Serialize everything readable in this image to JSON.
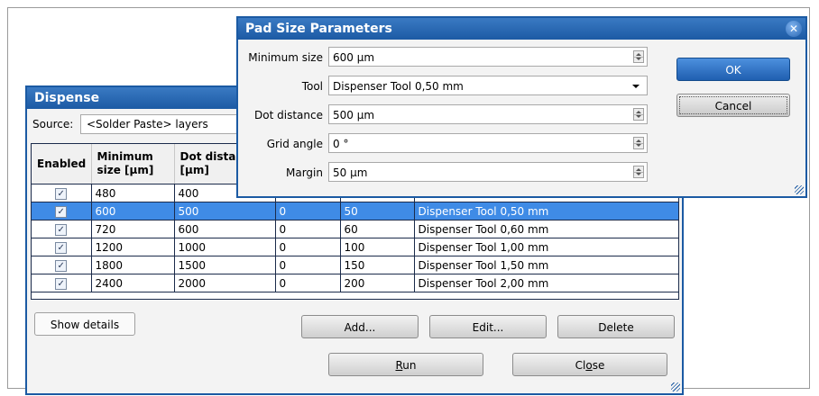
{
  "dispense": {
    "title": "Dispense",
    "source_label": "Source:",
    "source_value": "<Solder Paste> layers",
    "columns": {
      "enabled": "Enabled",
      "min_size_1": "Minimum",
      "min_size_2": "size [µm]",
      "dot_dist_1": "Dot distan",
      "dot_dist_2": "[µm]"
    },
    "rows": [
      {
        "enabled": true,
        "min_size": "480",
        "dot_distance": "400",
        "grid_angle": "",
        "margin": "",
        "tool": ""
      },
      {
        "enabled": true,
        "min_size": "600",
        "dot_distance": "500",
        "grid_angle": "0",
        "margin": "50",
        "tool": "Dispenser Tool 0,50 mm"
      },
      {
        "enabled": true,
        "min_size": "720",
        "dot_distance": "600",
        "grid_angle": "0",
        "margin": "60",
        "tool": "Dispenser Tool 0,60 mm"
      },
      {
        "enabled": true,
        "min_size": "1200",
        "dot_distance": "1000",
        "grid_angle": "0",
        "margin": "100",
        "tool": "Dispenser Tool 1,00 mm"
      },
      {
        "enabled": true,
        "min_size": "1800",
        "dot_distance": "1500",
        "grid_angle": "0",
        "margin": "150",
        "tool": "Dispenser Tool 1,50 mm"
      },
      {
        "enabled": true,
        "min_size": "2400",
        "dot_distance": "2000",
        "grid_angle": "0",
        "margin": "200",
        "tool": "Dispenser Tool 2,00 mm"
      }
    ],
    "selected_row_index": 1,
    "buttons": {
      "show_details": "Show details",
      "add": "Add...",
      "edit": "Edit...",
      "delete": "Delete",
      "run_mnemonic": "R",
      "run_rest": "un",
      "close_prefix": "Cl",
      "close_mnemonic": "o",
      "close_rest": "se"
    }
  },
  "pad": {
    "title": "Pad Size Parameters",
    "fields": {
      "min_size_label": "Minimum size",
      "min_size_value": "600 µm",
      "tool_label": "Tool",
      "tool_value": "Dispenser Tool 0,50 mm",
      "dot_distance_label": "Dot distance",
      "dot_distance_value": "500 µm",
      "grid_angle_label": "Grid angle",
      "grid_angle_value": "0 °",
      "margin_label": "Margin",
      "margin_value": "50 µm"
    },
    "ok": "OK",
    "cancel": "Cancel"
  },
  "icons": {
    "close": "close-icon",
    "checkbox": "checkbox-checked-icon",
    "dropdown": "chevron-down-icon",
    "spinner": "spinner-icon",
    "resize": "resize-grip-icon"
  },
  "colors": {
    "title_blue": "#1c5aa4",
    "selection_blue": "#3f8be6",
    "ok_blue": "#1f5fb0"
  }
}
